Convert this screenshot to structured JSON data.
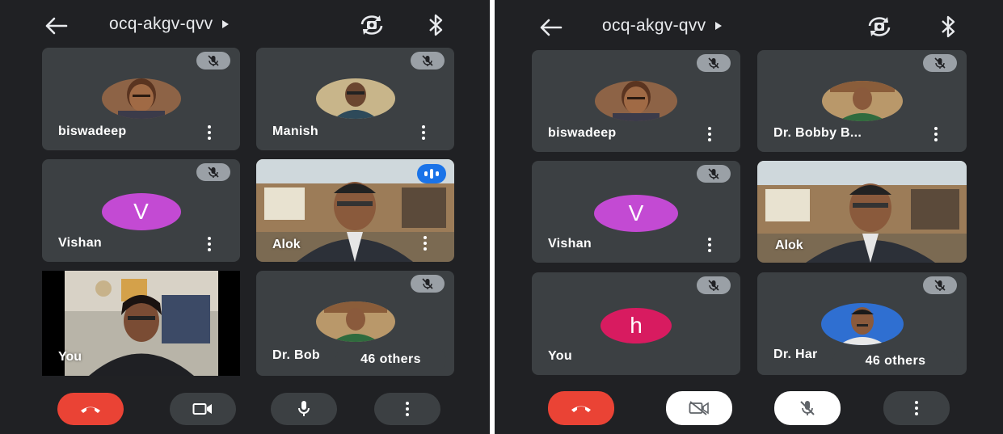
{
  "meeting_code": "ocq-akgv-qvv",
  "colors": {
    "background": "#202124",
    "tile": "#3c4043",
    "end_call": "#ea4335",
    "speaking": "#1a73e8",
    "avatar_v": "#c34ad3",
    "avatar_h": "#d81b60"
  },
  "left": {
    "tiles": {
      "biswadeep": {
        "name": "biswadeep",
        "muted": true
      },
      "manish": {
        "name": "Manish",
        "muted": true
      },
      "vishan": {
        "name": "Vishan",
        "initial": "V",
        "muted": true
      },
      "alok": {
        "name": "Alok",
        "speaking": true
      },
      "you": {
        "name": "You"
      },
      "bobby": {
        "name": "Dr. Bob",
        "muted": true
      }
    },
    "others_label": "46 others",
    "controls": [
      "end-call",
      "camera-on",
      "mic-on",
      "more-options"
    ]
  },
  "right": {
    "tiles": {
      "biswadeep": {
        "name": "biswadeep",
        "muted": true
      },
      "bobby": {
        "name": "Dr. Bobby B...",
        "muted": true
      },
      "vishan": {
        "name": "Vishan",
        "initial": "V",
        "muted": true
      },
      "alok": {
        "name": "Alok"
      },
      "you": {
        "name": "You",
        "initial": "h",
        "muted": true
      },
      "harish": {
        "name": "Dr. Har",
        "muted": true
      }
    },
    "others_label": "46 others",
    "controls": [
      "end-call",
      "camera-off",
      "mic-off",
      "more-options"
    ]
  },
  "icons": [
    "arrow-left-icon",
    "play-triangle-icon",
    "camera-flip-icon",
    "bluetooth-icon",
    "mic-off-icon",
    "more-vert-icon",
    "speaking-indicator-icon",
    "end-call-icon",
    "videocam-icon",
    "videocam-off-icon",
    "mic-icon"
  ]
}
